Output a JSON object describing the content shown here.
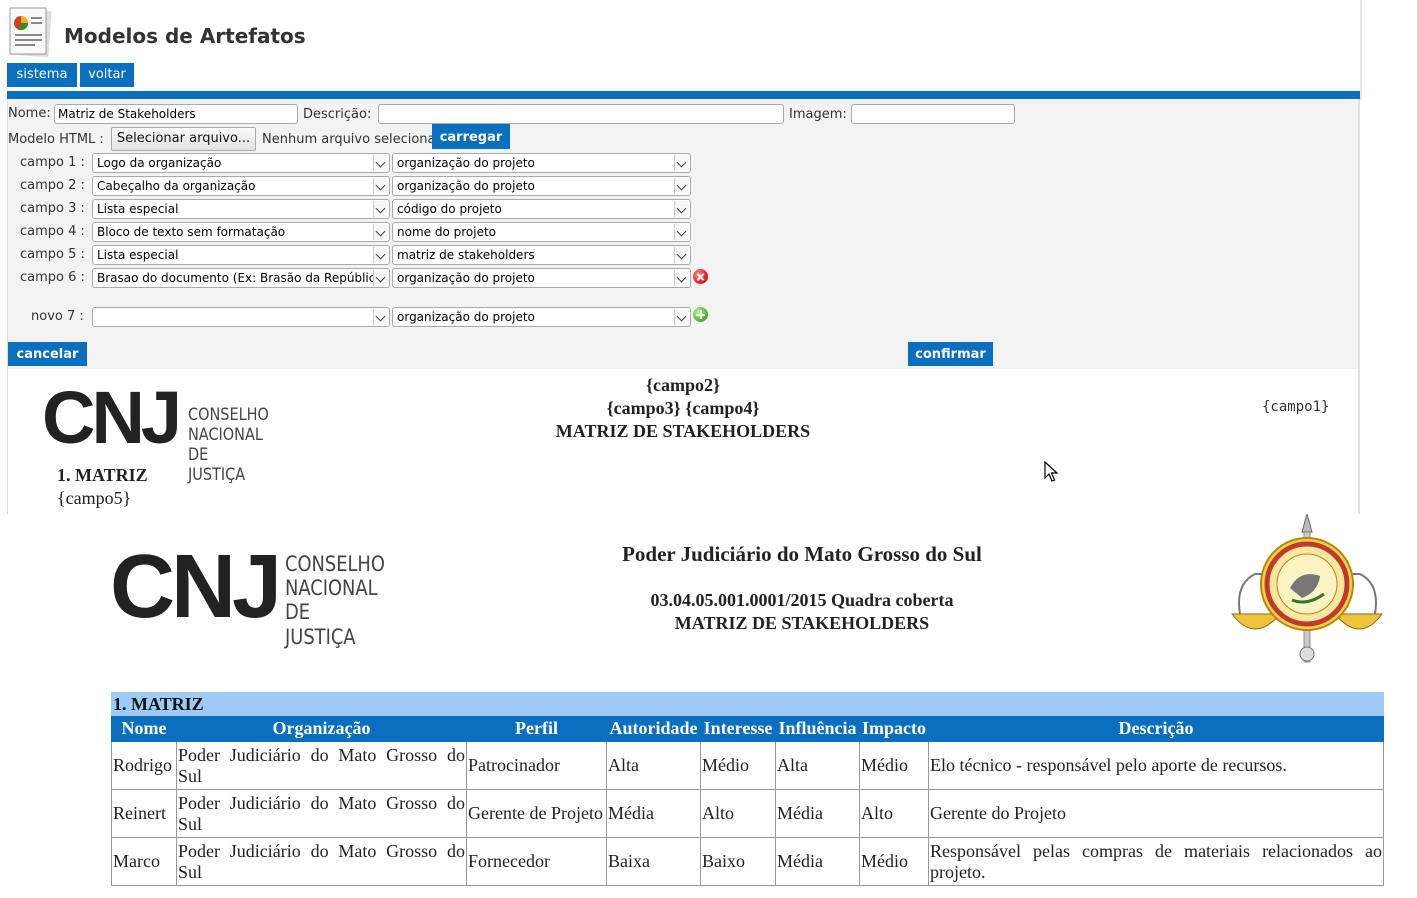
{
  "app": {
    "title": "Modelos de Artefatos",
    "nav": [
      {
        "label": "sistema"
      },
      {
        "label": "voltar"
      }
    ]
  },
  "form": {
    "nome_label": "Nome:",
    "nome_value": "Matriz de Stakeholders",
    "descricao_label": "Descrição:",
    "descricao_value": "",
    "imagem_label": "Imagem:",
    "imagem_value": "",
    "modelo_label": "Modelo HTML :",
    "file_button": "Selecionar arquivo...",
    "file_status": "Nenhum arquivo selecionado.",
    "upload_button": "carregar",
    "fields": [
      {
        "label": "campo 1 :",
        "type": "Logo da organização",
        "source": "organização do projeto"
      },
      {
        "label": "campo 2 :",
        "type": "Cabeçalho da organização",
        "source": "organização do projeto"
      },
      {
        "label": "campo 3 :",
        "type": "Lista especial",
        "source": "código do projeto"
      },
      {
        "label": "campo 4 :",
        "type": "Bloco de texto sem formatação",
        "source": "nome do projeto"
      },
      {
        "label": "campo 5 :",
        "type": "Lista especial",
        "source": "matriz de stakeholders"
      },
      {
        "label": "campo 6 :",
        "type": "Brasao do documento (Ex: Brasão da República)",
        "source": "organização do projeto"
      }
    ],
    "new_field": {
      "label": "novo 7 :",
      "type": "",
      "source": "organização do projeto"
    },
    "cancel_button": "cancelar",
    "confirm_button": "confirmar"
  },
  "template_preview": {
    "logo": {
      "mark": "CNJ",
      "line1": "CONSELHO",
      "line2": "NACIONAL",
      "line3": "DE JUSTIÇA"
    },
    "line1": "{campo2}",
    "line2": "{campo3} {campo4}",
    "line3": "MATRIZ DE STAKEHOLDERS",
    "right_placeholder": "{campo1}",
    "section_title": "1. MATRIZ",
    "section_placeholder": "{campo5}"
  },
  "document": {
    "logo": {
      "mark": "CNJ",
      "line1": "CONSELHO",
      "line2": "NACIONAL",
      "line3": "DE JUSTIÇA"
    },
    "org_name": "Poder Judiciário do Mato Grosso do Sul",
    "project": "03.04.05.001.0001/2015 Quadra coberta",
    "title": "MATRIZ DE STAKEHOLDERS",
    "seal_icon": "court-coat-of-arms",
    "section_title": "1. MATRIZ",
    "table": {
      "headers": [
        "Nome",
        "Organização",
        "Perfil",
        "Autoridade",
        "Interesse",
        "Influência",
        "Impacto",
        "Descrição"
      ],
      "rows": [
        [
          "Rodrigo",
          "Poder Judiciário do Mato Grosso do Sul",
          "Patrocinador",
          "Alta",
          "Médio",
          "Alta",
          "Médio",
          "Elo técnico - responsável pelo aporte de recursos."
        ],
        [
          "Reinert",
          "Poder Judiciário do Mato Grosso do Sul",
          "Gerente de Projeto",
          "Média",
          "Alto",
          "Média",
          "Alto",
          "Gerente do Projeto"
        ],
        [
          "Marco",
          "Poder Judiciário do Mato Grosso do Sul",
          "Fornecedor",
          "Baixa",
          "Baixo",
          "Média",
          "Médio",
          "Responsável pelas compras de materiais relacionados ao projeto."
        ]
      ]
    }
  },
  "colors": {
    "accent": "#0a6fbf",
    "section_bg": "#9ecbf5",
    "panel_bg": "#f3f3f3"
  }
}
